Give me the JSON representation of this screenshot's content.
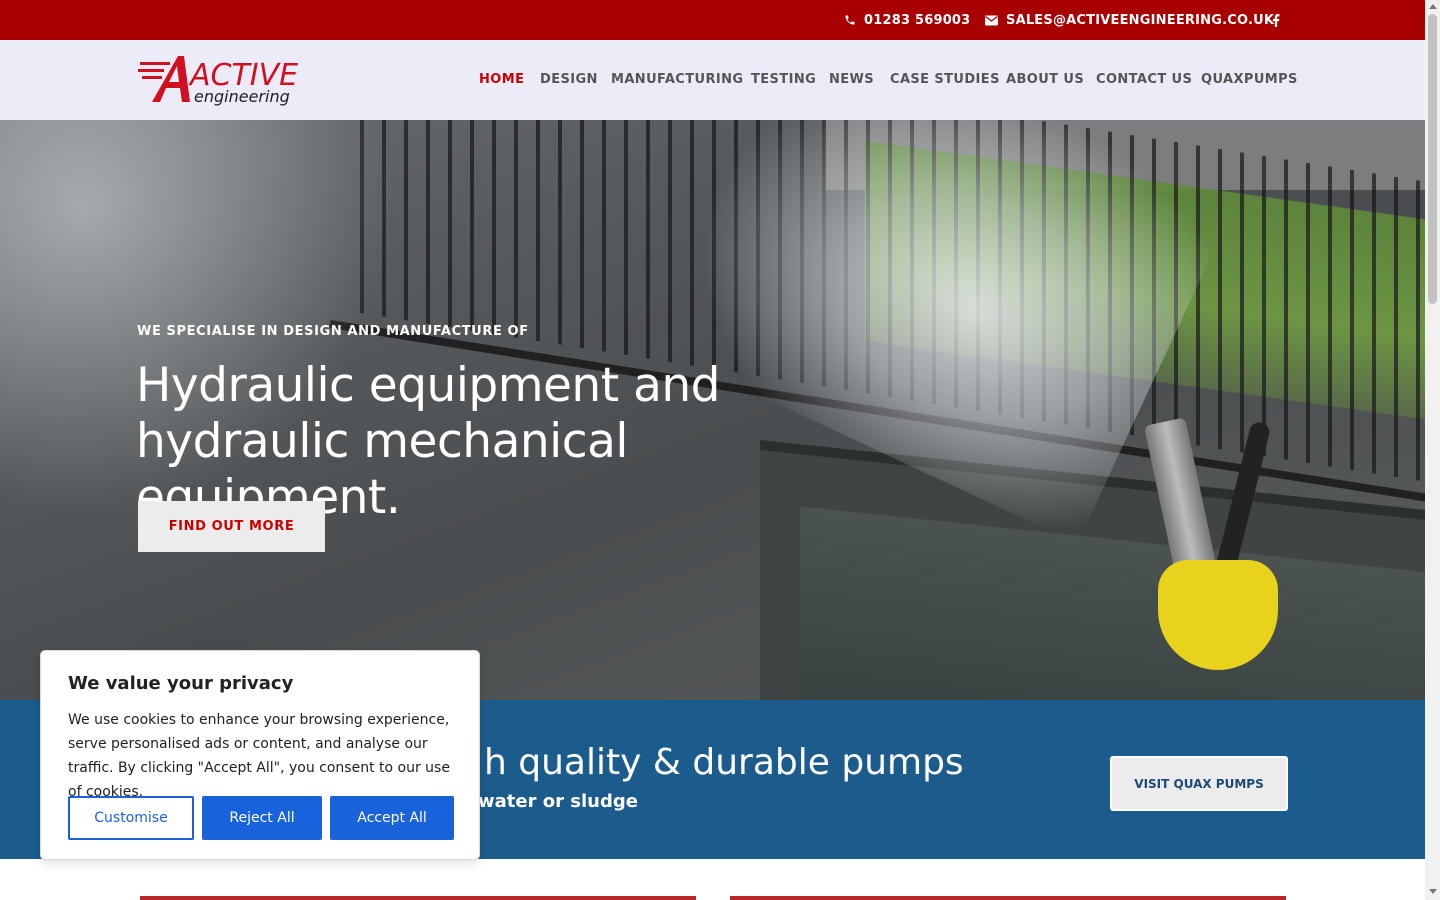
{
  "topbar": {
    "phone": "01283 569003",
    "email": "SALES@ACTIVEENGINEERING.CO.UK",
    "social_icon": "facebook-icon",
    "background_color": "#a80000"
  },
  "logo": {
    "word_top": "ACTIVE",
    "word_bottom": "engineering",
    "color": "#d01020"
  },
  "nav": {
    "items": [
      {
        "label": "HOME",
        "active": true
      },
      {
        "label": "DESIGN",
        "active": false
      },
      {
        "label": "MANUFACTURING",
        "active": false
      },
      {
        "label": "TESTING",
        "active": false
      },
      {
        "label": "NEWS",
        "active": false
      },
      {
        "label": "CASE STUDIES",
        "active": false
      },
      {
        "label": "ABOUT US",
        "active": false
      },
      {
        "label": "CONTACT US",
        "active": false
      },
      {
        "label": "QUAXPUMPS",
        "active": false
      }
    ],
    "active_color": "#cc0000"
  },
  "hero": {
    "subtitle": "WE SPECIALISE IN DESIGN AND MANUFACTURE OF",
    "title_line1": "Hydraulic equipment and",
    "title_line2": "hydraulic mechanical equipment.",
    "button_label": "FIND OUT MORE"
  },
  "band": {
    "title_visible": "h quality & durable pumps",
    "subtitle_visible": "water or sludge",
    "button_label": "VISIT QUAX PUMPS",
    "background_color": "#1c5c8c"
  },
  "cookie": {
    "title": "We value your privacy",
    "text": "We use cookies to enhance your browsing experience, serve personalised ads or content, and analyse our traffic. By clicking \"Accept All\", you consent to our use of cookies.",
    "customise_label": "Customise",
    "reject_label": "Reject All",
    "accept_label": "Accept All",
    "accent_color": "#1863dc"
  }
}
